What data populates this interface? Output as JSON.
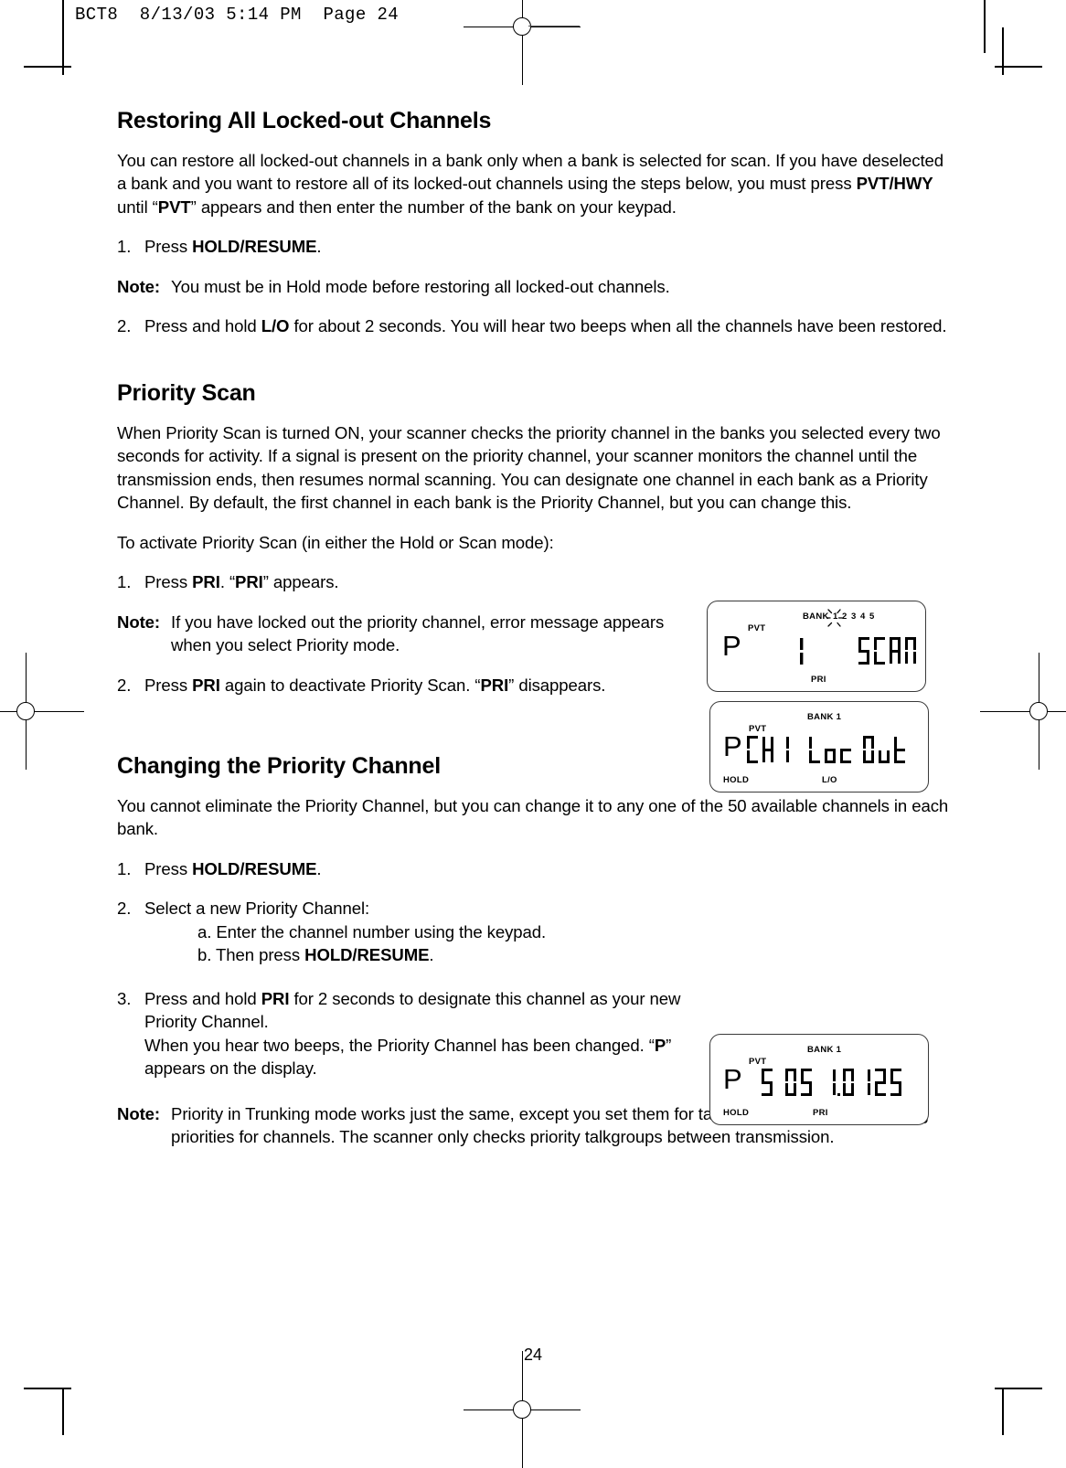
{
  "print_header": {
    "text": "BCT8  8/13/03 5:14 PM  Page 24"
  },
  "page_number": "24",
  "sections": [
    {
      "heading": "Restoring All Locked-out Channels",
      "paragraph": "You can restore all locked-out channels in a bank only when a bank is selected for scan. If you have deselected a bank and you want to restore all of its locked-out channels using the steps below, you must press PVT/HWY until “PVT” appears and then enter the number of the bank on your keypad."
    }
  ],
  "s1": {
    "heading": "Restoring All Locked-out Channels",
    "para_a": "You can restore all locked-out channels in a bank only when a bank is selected for scan. If you have deselected a bank and you want to restore all of its locked-out channels using the steps below, you must press ",
    "para_b": "PVT/HWY",
    "para_c": " until “",
    "para_d": "PVT",
    "para_e": "” appears and then enter the number of the bank on your keypad.",
    "step1_num": "1.",
    "step1_pre": "Press ",
    "step1_bold": "HOLD/RESUME",
    "step1_post": ".",
    "note_label": "Note:",
    "note_text": "You must be in Hold mode before restoring all locked-out channels.",
    "step2_num": "2.",
    "step2_pre": "Press and hold ",
    "step2_bold": "L/O",
    "step2_post": " for about 2 seconds. You will hear two beeps when all the channels have been restored."
  },
  "s2": {
    "heading": "Priority Scan",
    "para": "When Priority Scan is turned ON, your scanner checks the priority channel in the banks you selected every two seconds for activity. If a signal is present on the priority channel, your scanner monitors the channel until the transmission ends, then resumes normal scanning. You can designate one channel in each bank as a Priority Channel. By default, the first channel in each bank is the Priority Channel, but you can change this.",
    "intro": "To activate Priority Scan (in either the Hold or Scan mode):",
    "step1_num": "1.",
    "step1_pre": "Press ",
    "step1_bold": "PRI",
    "step1_mid": ". “",
    "step1_bold2": "PRI",
    "step1_post": "” appears.",
    "note_label": "Note:",
    "note_text": "If you have locked out the priority channel, error message appears when you select Priority mode.",
    "step2_num": "2.",
    "step2_pre": "Press ",
    "step2_bold": "PRI",
    "step2_mid": " again to deactivate Priority Scan. “",
    "step2_bold2": "PRI",
    "step2_post": "” disappears."
  },
  "s3": {
    "heading": "Changing the Priority Channel",
    "para": "You cannot eliminate the Priority Channel, but you can change it to any one of the 50 available channels in each bank.",
    "step1_num": "1.",
    "step1_pre": "Press ",
    "step1_bold": "HOLD/RESUME",
    "step1_post": ".",
    "step2_num": "2.",
    "step2_text": "Select a new Priority Channel:",
    "step2a": "a. Enter the channel number using the keypad.",
    "step2b_pre": "b. Then press ",
    "step2b_bold": "HOLD/RESUME",
    "step2b_post": ".",
    "step3_num": "3.",
    "step3_pre": "Press and hold ",
    "step3_bold": "PRI",
    "step3_mid": " for 2 seconds to designate this channel as your new Priority Channel.",
    "step3_line2": "When you hear two beeps, the Priority Channel has been changed. “",
    "step3_bold2": "P",
    "step3_post": "” appears on the display.",
    "note_label": "Note:",
    "note_text": "Priority in Trunking mode works just the same, except you set them for talkgroup IDs instead of setting priorities for channels. The scanner only checks priority talkgroups between transmission."
  },
  "lcd_panels": [
    {
      "id": "lcd-scan",
      "p_indicator": "P",
      "pvt": "PVT",
      "bank_label": "BANK",
      "bank_digits": [
        "1",
        "2",
        "3",
        "4",
        "5"
      ],
      "blinking_bank": "1",
      "pri": "PRI",
      "hold": "",
      "lo": "",
      "channel_digits": "1",
      "segment_text": "SCAN"
    },
    {
      "id": "lcd-locout",
      "p_indicator": "P",
      "pvt": "PVT",
      "bank_label": "BANK 1",
      "bank_digits": [],
      "blinking_bank": "",
      "pri": "",
      "hold": "HOLD",
      "lo": "L/O",
      "channel_digits": "",
      "segment_text": "CH1 LocOut"
    },
    {
      "id": "lcd-freq",
      "p_indicator": "P",
      "pvt": "PVT",
      "bank_label": "BANK 1",
      "bank_digits": [],
      "blinking_bank": "",
      "pri": "PRI",
      "hold": "HOLD",
      "lo": "",
      "channel_digits": "",
      "segment_text": "505 10125"
    }
  ],
  "colors": {
    "ink": "#000000",
    "paper": "#ffffff",
    "lcd_border": "#3a3a3a",
    "rule": "#555555"
  }
}
